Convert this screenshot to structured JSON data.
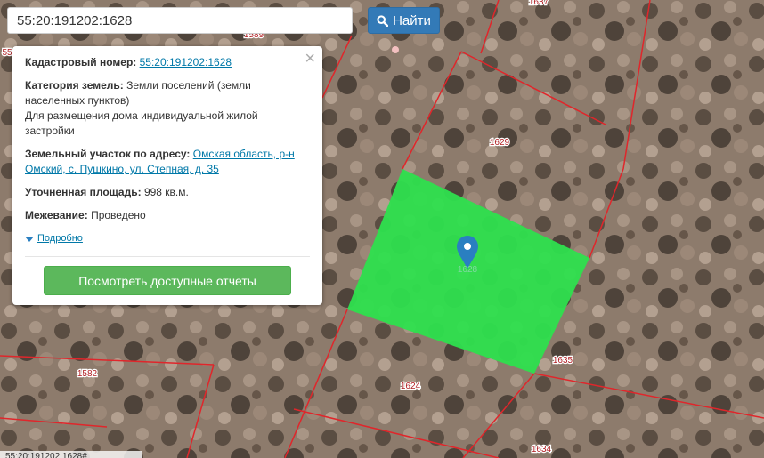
{
  "search": {
    "value": "55:20:191202:1628",
    "button_label": "Найти",
    "button_icon": "search-icon"
  },
  "popup": {
    "cadastral_label": "Кадастровый номер:",
    "cadastral_value": "55:20:191202:1628",
    "category_label": "Категория земель:",
    "category_value": "Земли поселений (земли населенных пунктов)",
    "usage": "Для размещения дома индивидуальной жилой застройки",
    "address_label": "Земельный участок по адресу:",
    "address_value": "Омская область, р-н Омский, с. Пушкино, ул. Степная, д. 35",
    "area_label": "Уточненная площадь:",
    "area_value": "998 кв.м.",
    "survey_label": "Межевание:",
    "survey_value": "Проведено",
    "more_link": "Подробно",
    "reports_button": "Посмотреть доступные отчеты",
    "close_glyph": "×"
  },
  "map": {
    "parcel_labels": [
      "1637",
      "1589",
      "55",
      "1629",
      "1628",
      "1635",
      "1624",
      "1582",
      "1634"
    ],
    "selected_parcel": "1628",
    "colors": {
      "selected_fill": "#2ee04e",
      "boundary": "#e0262b",
      "marker": "#2a7fc1",
      "label_text": "#b01e22"
    }
  },
  "footer_text": "55:20:191202:1628#"
}
